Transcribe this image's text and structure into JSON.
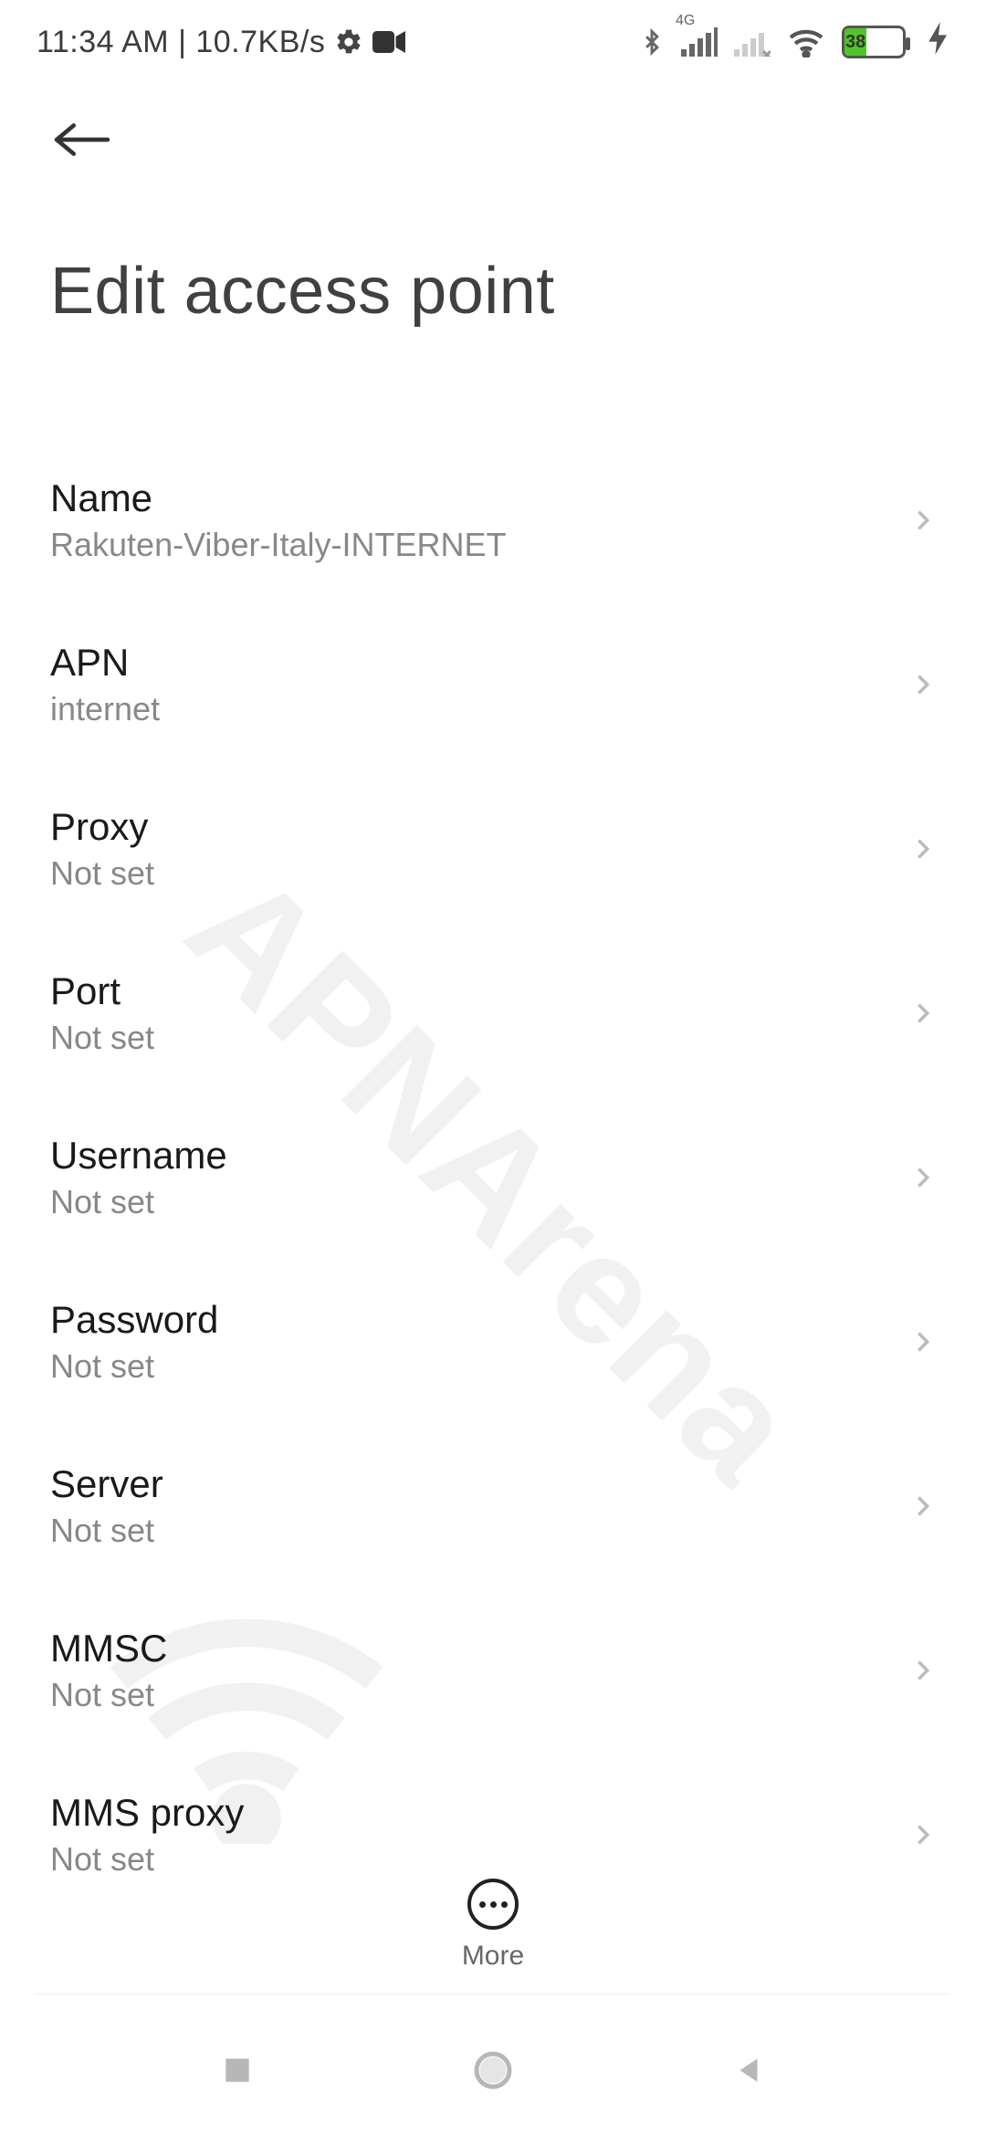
{
  "status": {
    "time_text": "11:34 AM | 10.7KB/s",
    "network_type": "4G",
    "battery_text": "38"
  },
  "header": {
    "title": "Edit access point"
  },
  "rows": [
    {
      "label": "Name",
      "value": "Rakuten-Viber-Italy-INTERNET"
    },
    {
      "label": "APN",
      "value": "internet"
    },
    {
      "label": "Proxy",
      "value": "Not set"
    },
    {
      "label": "Port",
      "value": "Not set"
    },
    {
      "label": "Username",
      "value": "Not set"
    },
    {
      "label": "Password",
      "value": "Not set"
    },
    {
      "label": "Server",
      "value": "Not set"
    },
    {
      "label": "MMSC",
      "value": "Not set"
    },
    {
      "label": "MMS proxy",
      "value": "Not set"
    }
  ],
  "bottom": {
    "more_label": "More"
  },
  "watermark": "APNArena"
}
